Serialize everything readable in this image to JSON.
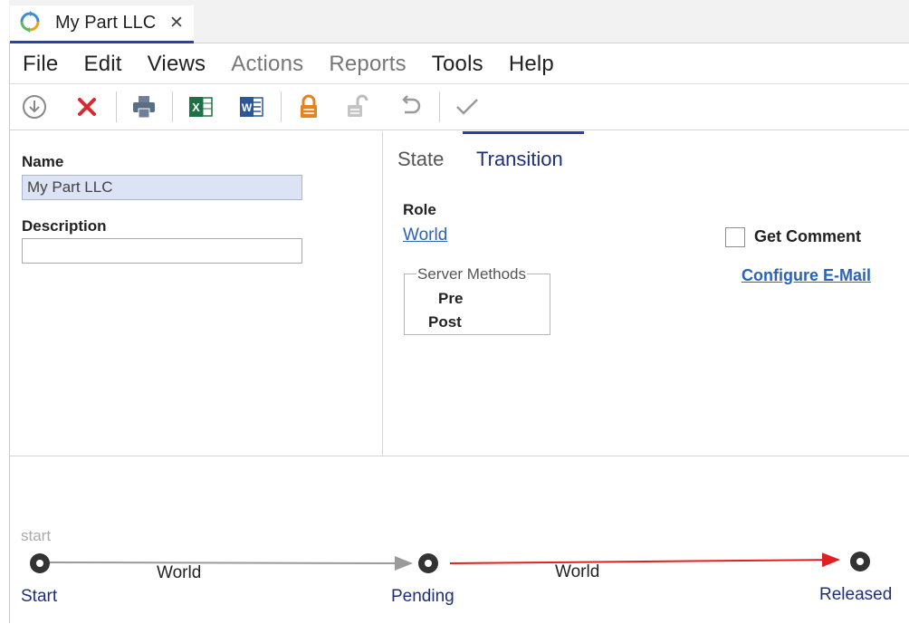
{
  "tab": {
    "title": "My Part LLC",
    "close": "✕",
    "icon": "refresh-cycle-icon"
  },
  "menu": [
    {
      "label": "File",
      "enabled": true
    },
    {
      "label": "Edit",
      "enabled": true
    },
    {
      "label": "Views",
      "enabled": true
    },
    {
      "label": "Actions",
      "enabled": false
    },
    {
      "label": "Reports",
      "enabled": false
    },
    {
      "label": "Tools",
      "enabled": true
    },
    {
      "label": "Help",
      "enabled": true
    }
  ],
  "toolbar": {
    "icons": [
      "download-icon",
      "delete-icon",
      "print-icon",
      "excel-icon",
      "word-icon",
      "lock-icon",
      "unlock-icon",
      "undo-icon",
      "checkmark-icon"
    ]
  },
  "form": {
    "name_label": "Name",
    "name_value": "My Part LLC",
    "description_label": "Description",
    "description_value": ""
  },
  "transition_panel": {
    "tabs": [
      "State",
      "Transition"
    ],
    "active_tab": "Transition",
    "role_label": "Role",
    "role_value": "World",
    "get_comment_label": "Get Comment",
    "get_comment_checked": false,
    "configure_email": "Configure E-Mail",
    "server_methods_legend": "Server Methods",
    "pre_label": "Pre",
    "post_label": "Post"
  },
  "workflow": {
    "start_hint": "start",
    "nodes": [
      "Start",
      "Pending",
      "Released"
    ],
    "edges": [
      {
        "from": "Start",
        "to": "Pending",
        "label": "World",
        "highlighted": false
      },
      {
        "from": "Pending",
        "to": "Released",
        "label": "World",
        "highlighted": true
      }
    ]
  },
  "colors": {
    "accent": "#2c3fa8",
    "link": "#2b63b6",
    "delete_red": "#d9282e",
    "excel_green": "#1e7145",
    "word_blue": "#2b579a",
    "lock_orange": "#e8821c",
    "active_edge": "#e02020"
  }
}
